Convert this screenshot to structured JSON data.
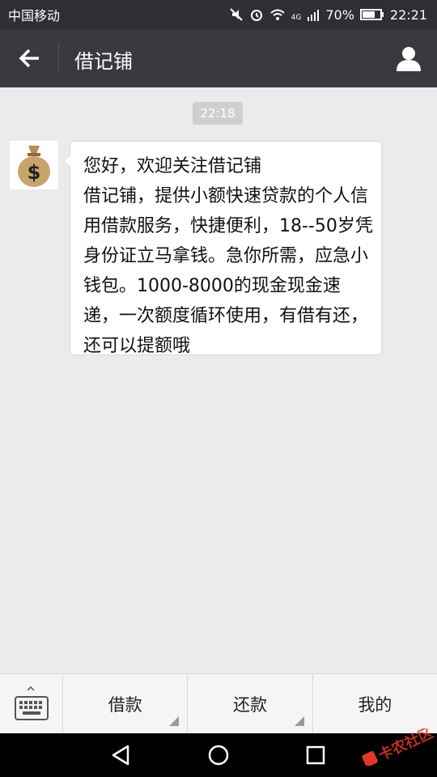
{
  "status_bar": {
    "carrier": "中国移动",
    "network": "4G",
    "battery": "70%",
    "time": "22:21"
  },
  "header": {
    "title": "借记铺",
    "back_icon": "back-arrow-icon",
    "profile_icon": "user-icon"
  },
  "chat": {
    "timestamp": "22:18",
    "avatar_icon": "money-bag-icon",
    "message": "您好，欢迎关注借记铺\n借记铺，提供小额快速贷款的个人信用借款服务，快捷便利，18--50岁凭身份证立马拿钱。急你所需，应急小钱包。1000-8000的现金现金速递，一次额度循环使用，有借有还，还可以提额哦"
  },
  "menu": {
    "keyboard_icon": "keyboard-icon",
    "items": [
      {
        "label": "借款",
        "has_submenu": true
      },
      {
        "label": "还款",
        "has_submenu": true
      },
      {
        "label": "我的",
        "has_submenu": false
      }
    ]
  },
  "nav_bar": {
    "icons": [
      "back-triangle-icon",
      "home-circle-icon",
      "recents-square-icon"
    ]
  },
  "watermark": {
    "text": "卡农社区"
  },
  "colors": {
    "status_bg": "#2e2e33",
    "titlebar_bg": "#393a3f",
    "chat_bg": "#ebebeb",
    "bubble_bg": "#ffffff",
    "menu_bg": "#f5f5f5",
    "watermark": "#e0392b"
  }
}
